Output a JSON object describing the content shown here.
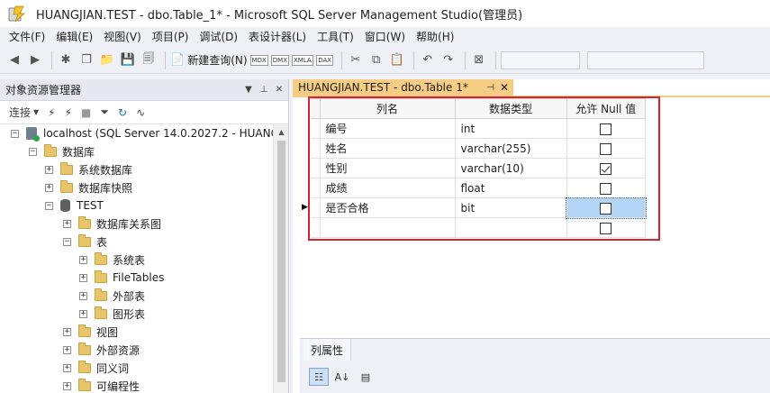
{
  "window": {
    "title": "HUANGJIAN.TEST - dbo.Table_1* - Microsoft SQL Server Management Studio(管理员)"
  },
  "menu": [
    "文件(F)",
    "编辑(E)",
    "视图(V)",
    "项目(P)",
    "调试(D)",
    "表设计器(L)",
    "工具(T)",
    "窗口(W)",
    "帮助(H)"
  ],
  "toolbar": {
    "new_query_label": "新建查询(N)",
    "mini_buttons": [
      "MDX",
      "DMX",
      "XMLA",
      "DAX"
    ]
  },
  "explorer": {
    "title": "对象资源管理器",
    "connect_label": "连接",
    "tree": [
      {
        "label": "localhost (SQL Server 14.0.2027.2 - HUANG",
        "expander": "−",
        "icon": "server-icon",
        "level": 0
      },
      {
        "label": "数据库",
        "expander": "−",
        "icon": "folder-icon",
        "level": 1
      },
      {
        "label": "系统数据库",
        "expander": "+",
        "icon": "folder-icon",
        "level": 2
      },
      {
        "label": "数据库快照",
        "expander": "+",
        "icon": "folder-icon",
        "level": 2
      },
      {
        "label": "TEST",
        "expander": "−",
        "icon": "db-icon",
        "level": 2
      },
      {
        "label": "数据库关系图",
        "expander": "+",
        "icon": "folder-icon",
        "level": 3
      },
      {
        "label": "表",
        "expander": "−",
        "icon": "folder-icon",
        "level": 3
      },
      {
        "label": "系统表",
        "expander": "+",
        "icon": "folder-icon",
        "level": 4
      },
      {
        "label": "FileTables",
        "expander": "+",
        "icon": "folder-icon",
        "level": 4
      },
      {
        "label": "外部表",
        "expander": "+",
        "icon": "folder-icon",
        "level": 4
      },
      {
        "label": "图形表",
        "expander": "+",
        "icon": "folder-icon",
        "level": 4
      },
      {
        "label": "视图",
        "expander": "+",
        "icon": "folder-icon",
        "level": 3
      },
      {
        "label": "外部资源",
        "expander": "+",
        "icon": "folder-icon",
        "level": 3
      },
      {
        "label": "同义词",
        "expander": "+",
        "icon": "folder-icon",
        "level": 3
      },
      {
        "label": "可编程性",
        "expander": "+",
        "icon": "folder-icon",
        "level": 3
      }
    ]
  },
  "document": {
    "tab_label": "HUANGJIAN.TEST - dbo.Table 1*",
    "columns": [
      "列名",
      "数据类型",
      "允许 Null 值"
    ],
    "rows": [
      {
        "name": "编号",
        "type": "int",
        "allow_null": false
      },
      {
        "name": "姓名",
        "type": "varchar(255)",
        "allow_null": false
      },
      {
        "name": "性别",
        "type": "varchar(10)",
        "allow_null": true
      },
      {
        "name": "成绩",
        "type": "float",
        "allow_null": false
      },
      {
        "name": "是否合格",
        "type": "bit",
        "allow_null": false,
        "current": true
      },
      {
        "name": "",
        "type": "",
        "allow_null": false
      }
    ]
  },
  "properties": {
    "tab_label": "列属性"
  }
}
